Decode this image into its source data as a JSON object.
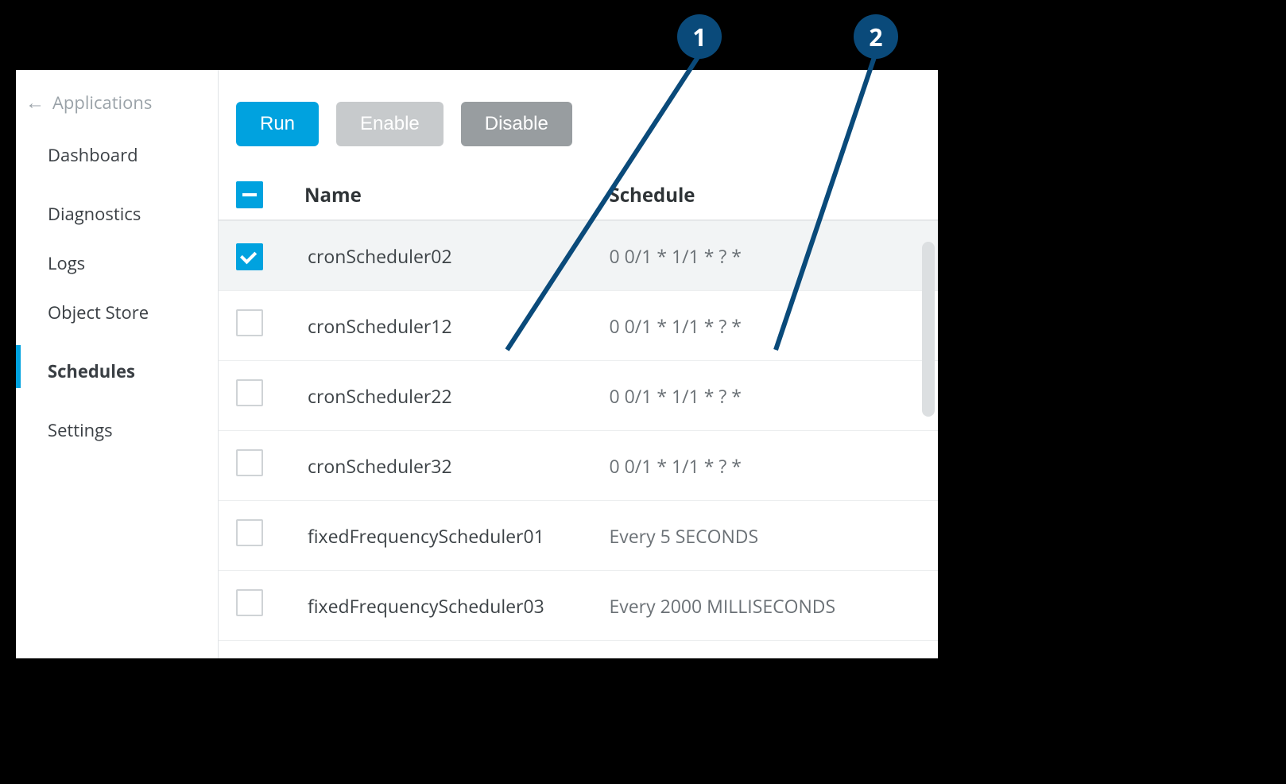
{
  "back": {
    "label": "Applications"
  },
  "sidebar": {
    "items": [
      {
        "label": "Dashboard",
        "active": false
      },
      {
        "label": "Diagnostics",
        "active": false
      },
      {
        "label": "Logs",
        "active": false
      },
      {
        "label": "Object Store",
        "active": false
      },
      {
        "label": "Schedules",
        "active": true
      },
      {
        "label": "Settings",
        "active": false
      }
    ]
  },
  "toolbar": {
    "run_label": "Run",
    "enable_label": "Enable",
    "disable_label": "Disable"
  },
  "table": {
    "headers": {
      "name": "Name",
      "schedule": "Schedule"
    },
    "rows": [
      {
        "name": "cronScheduler02",
        "schedule": "0 0/1 * 1/1 * ? *",
        "selected": true
      },
      {
        "name": "cronScheduler12",
        "schedule": "0 0/1 * 1/1 * ? *",
        "selected": false
      },
      {
        "name": "cronScheduler22",
        "schedule": "0 0/1 * 1/1 * ? *",
        "selected": false
      },
      {
        "name": "cronScheduler32",
        "schedule": "0 0/1 * 1/1 * ? *",
        "selected": false
      },
      {
        "name": "fixedFrequencyScheduler01",
        "schedule": "Every 5 SECONDS",
        "selected": false
      },
      {
        "name": "fixedFrequencyScheduler03",
        "schedule": "Every 2000 MILLISECONDS",
        "selected": false
      }
    ]
  },
  "callouts": {
    "c1": "1",
    "c2": "2"
  }
}
